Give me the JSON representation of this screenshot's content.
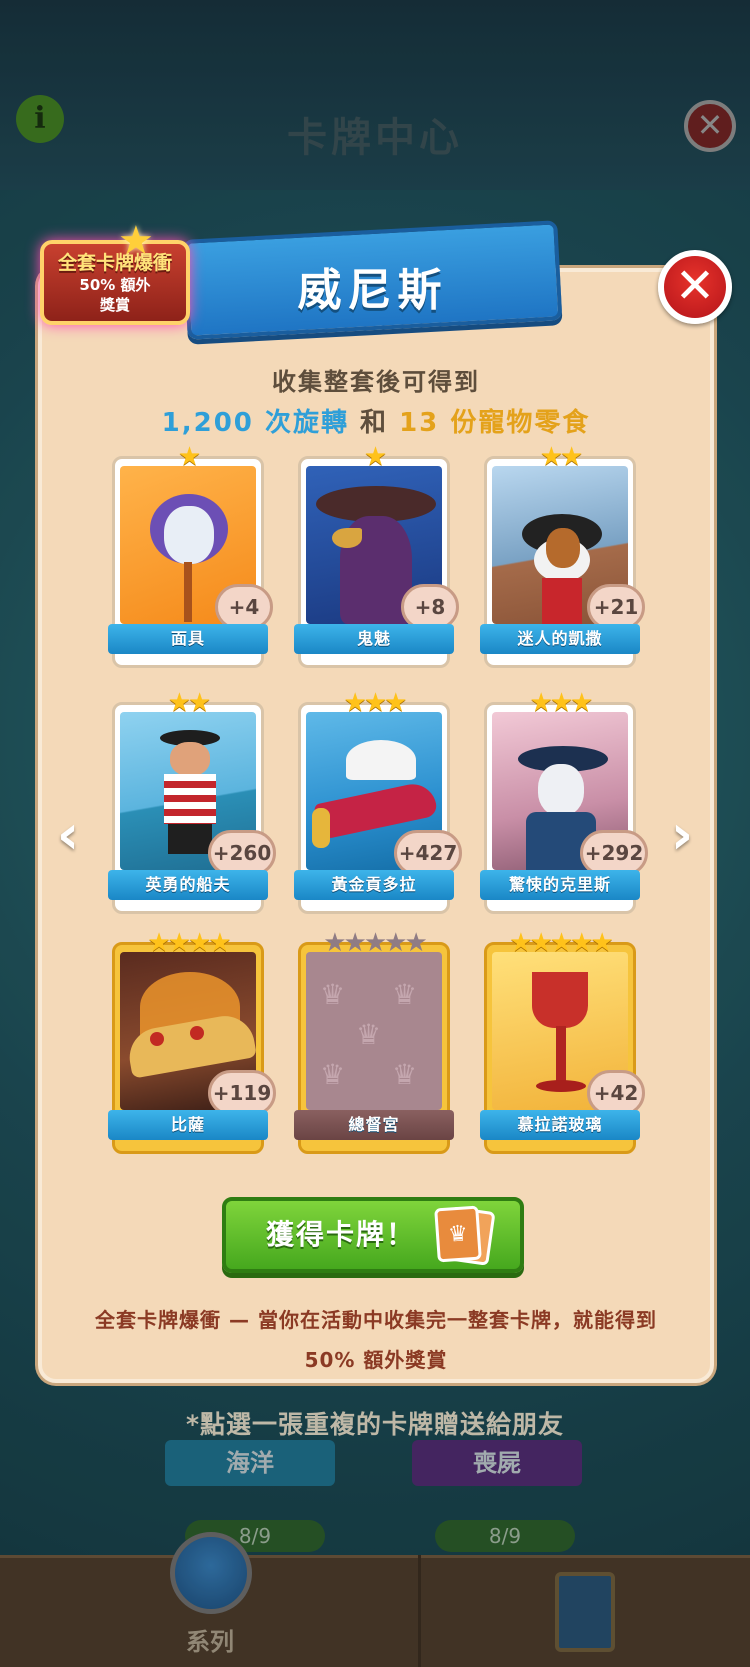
{
  "background": {
    "title": "卡牌中心",
    "hint": "*點選一張重複的卡牌贈送給朋友",
    "sets": [
      {
        "label": "海洋",
        "progress": "8/9"
      },
      {
        "label": "喪屍",
        "progress": "8/9"
      }
    ],
    "nav": {
      "series_label": "系列"
    }
  },
  "badge": {
    "title": "全套卡牌爆衝",
    "line1": "50% 額外",
    "line2": "獎賞"
  },
  "modal": {
    "title": "威尼斯",
    "reward_intro": "收集整套後可得到",
    "reward_spins": "1,200 次旋轉",
    "reward_and": "和",
    "reward_treats": "13 份寵物零食",
    "cards": [
      {
        "name": "面具",
        "stars": "★",
        "count": "+4"
      },
      {
        "name": "鬼魅",
        "stars": "★",
        "count": "+8"
      },
      {
        "name": "迷人的凱撒",
        "stars": "★★",
        "count": "+21"
      },
      {
        "name": "英勇的船夫",
        "stars": "★★",
        "count": "+260"
      },
      {
        "name": "黃金貢多拉",
        "stars": "★★★",
        "count": "+427"
      },
      {
        "name": "驚悚的克里斯",
        "stars": "★★★",
        "count": "+292"
      },
      {
        "name": "比薩",
        "stars": "★★★★",
        "count": "+119"
      },
      {
        "name": "總督宮",
        "stars": "★★★★★",
        "count": ""
      },
      {
        "name": "慕拉諾玻璃",
        "stars": "★★★★★",
        "count": "+42"
      }
    ],
    "button_label": "獲得卡牌！",
    "footer_line1": "全套卡牌爆衝 — 當你在活動中收集完一整套卡牌，就能得到",
    "footer_line2": "50% 額外獎賞"
  },
  "icons": {
    "info": "i",
    "close": "✕",
    "prev": "‹",
    "next": "›",
    "crown": "♛"
  },
  "colors": {
    "accent_blue": "#2f9fd8",
    "accent_gold": "#e4a21b",
    "button_green": "#46a81e",
    "close_red": "#d4212a"
  }
}
